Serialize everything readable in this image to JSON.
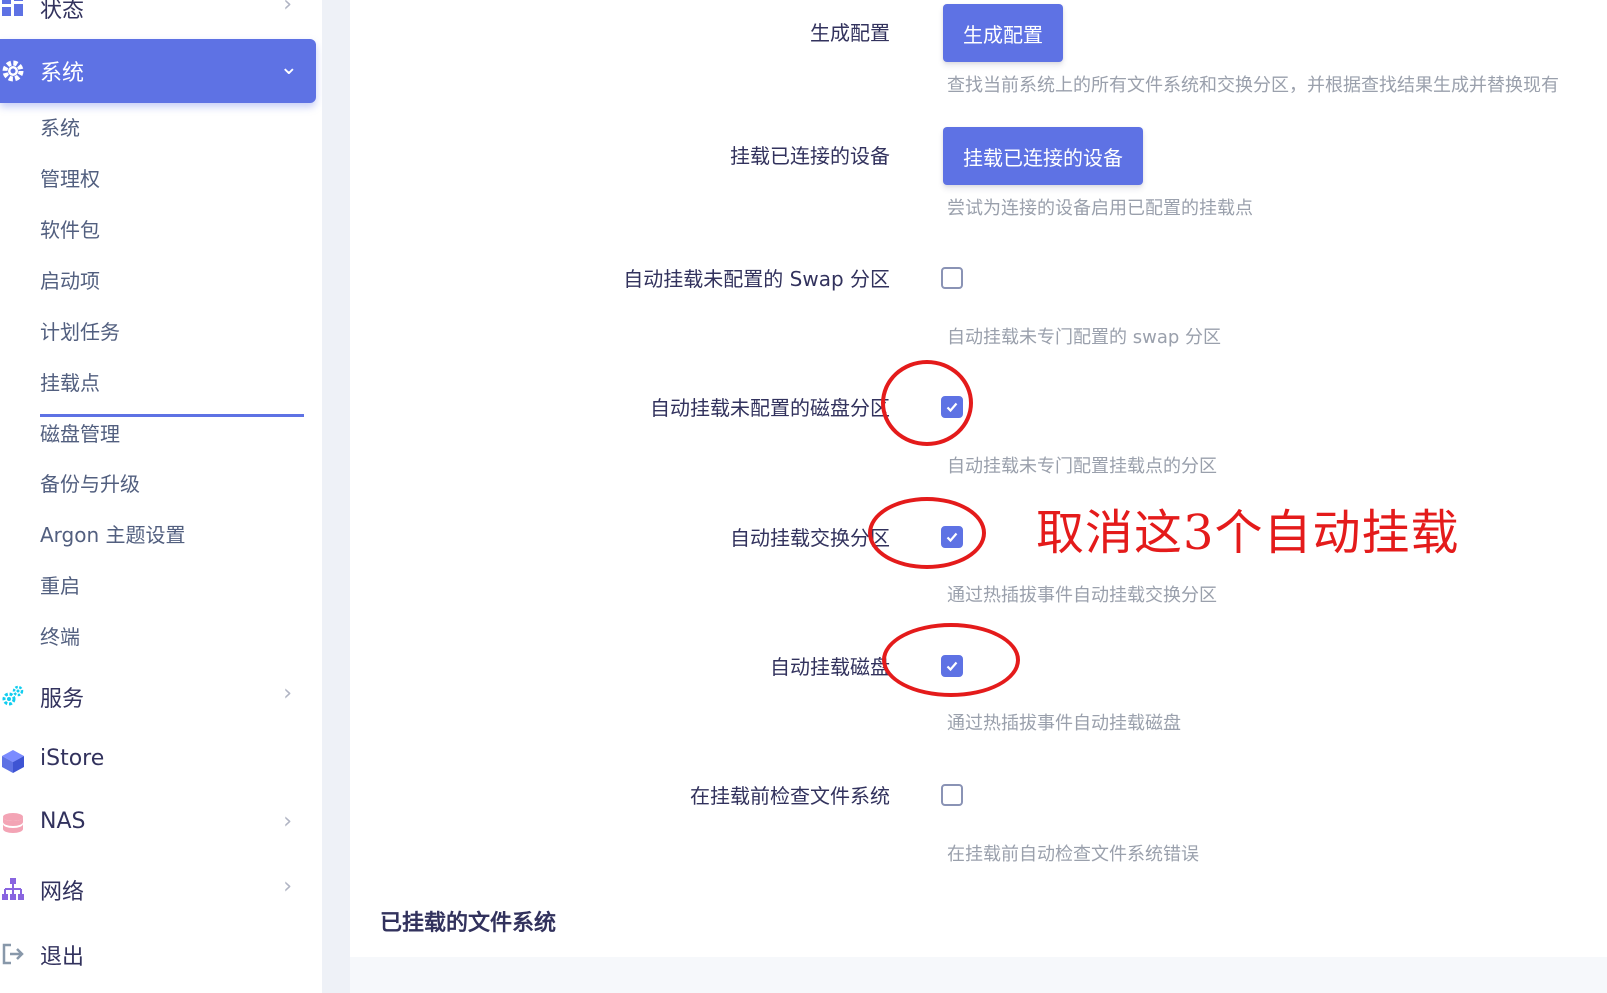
{
  "sidebar": {
    "top_item": {
      "label": "状态",
      "icon": "dashboard-icon"
    },
    "active_item": {
      "label": "系统",
      "icon": "gear-icon"
    },
    "sub_items": [
      "系统",
      "管理权",
      "软件包",
      "启动项",
      "计划任务",
      "挂载点",
      "磁盘管理",
      "备份与升级",
      "Argon 主题设置",
      "重启",
      "终端"
    ],
    "active_sub_item": "挂载点",
    "nav_items": [
      {
        "label": "服务",
        "icon": "cogs-icon",
        "has_chevron": true
      },
      {
        "label": "iStore",
        "icon": "cube-icon",
        "has_chevron": false
      },
      {
        "label": "NAS",
        "icon": "database-icon",
        "has_chevron": true
      },
      {
        "label": "网络",
        "icon": "sitemap-icon",
        "has_chevron": true
      },
      {
        "label": "退出",
        "icon": "sign-out-icon",
        "has_chevron": false
      }
    ]
  },
  "main": {
    "rows": [
      {
        "label": "生成配置",
        "button": "生成配置",
        "desc": "查找当前系统上的所有文件系统和交换分区，并根据查找结果生成并替换现有"
      },
      {
        "label": "挂载已连接的设备",
        "button": "挂载已连接的设备",
        "desc": "尝试为连接的设备启用已配置的挂载点"
      },
      {
        "label": "自动挂载未配置的 Swap 分区",
        "checked": false,
        "desc": "自动挂载未专门配置的 swap 分区"
      },
      {
        "label": "自动挂载未配置的磁盘分区",
        "checked": true,
        "desc": "自动挂载未专门配置挂载点的分区"
      },
      {
        "label": "自动挂载交换分区",
        "checked": true,
        "desc": "通过热插拔事件自动挂载交换分区"
      },
      {
        "label": "自动挂载磁盘",
        "checked": true,
        "desc": "通过热插拔事件自动挂载磁盘"
      },
      {
        "label": "在挂载前检查文件系统",
        "checked": false,
        "desc": "在挂载前自动检查文件系统错误"
      }
    ],
    "section_title": "已挂载的文件系统"
  },
  "annotation": {
    "text": "取消这3个自动挂载",
    "color": "#e41b1b"
  },
  "colors": {
    "accent": "#5e72e4",
    "annotation": "#e41b1b"
  }
}
